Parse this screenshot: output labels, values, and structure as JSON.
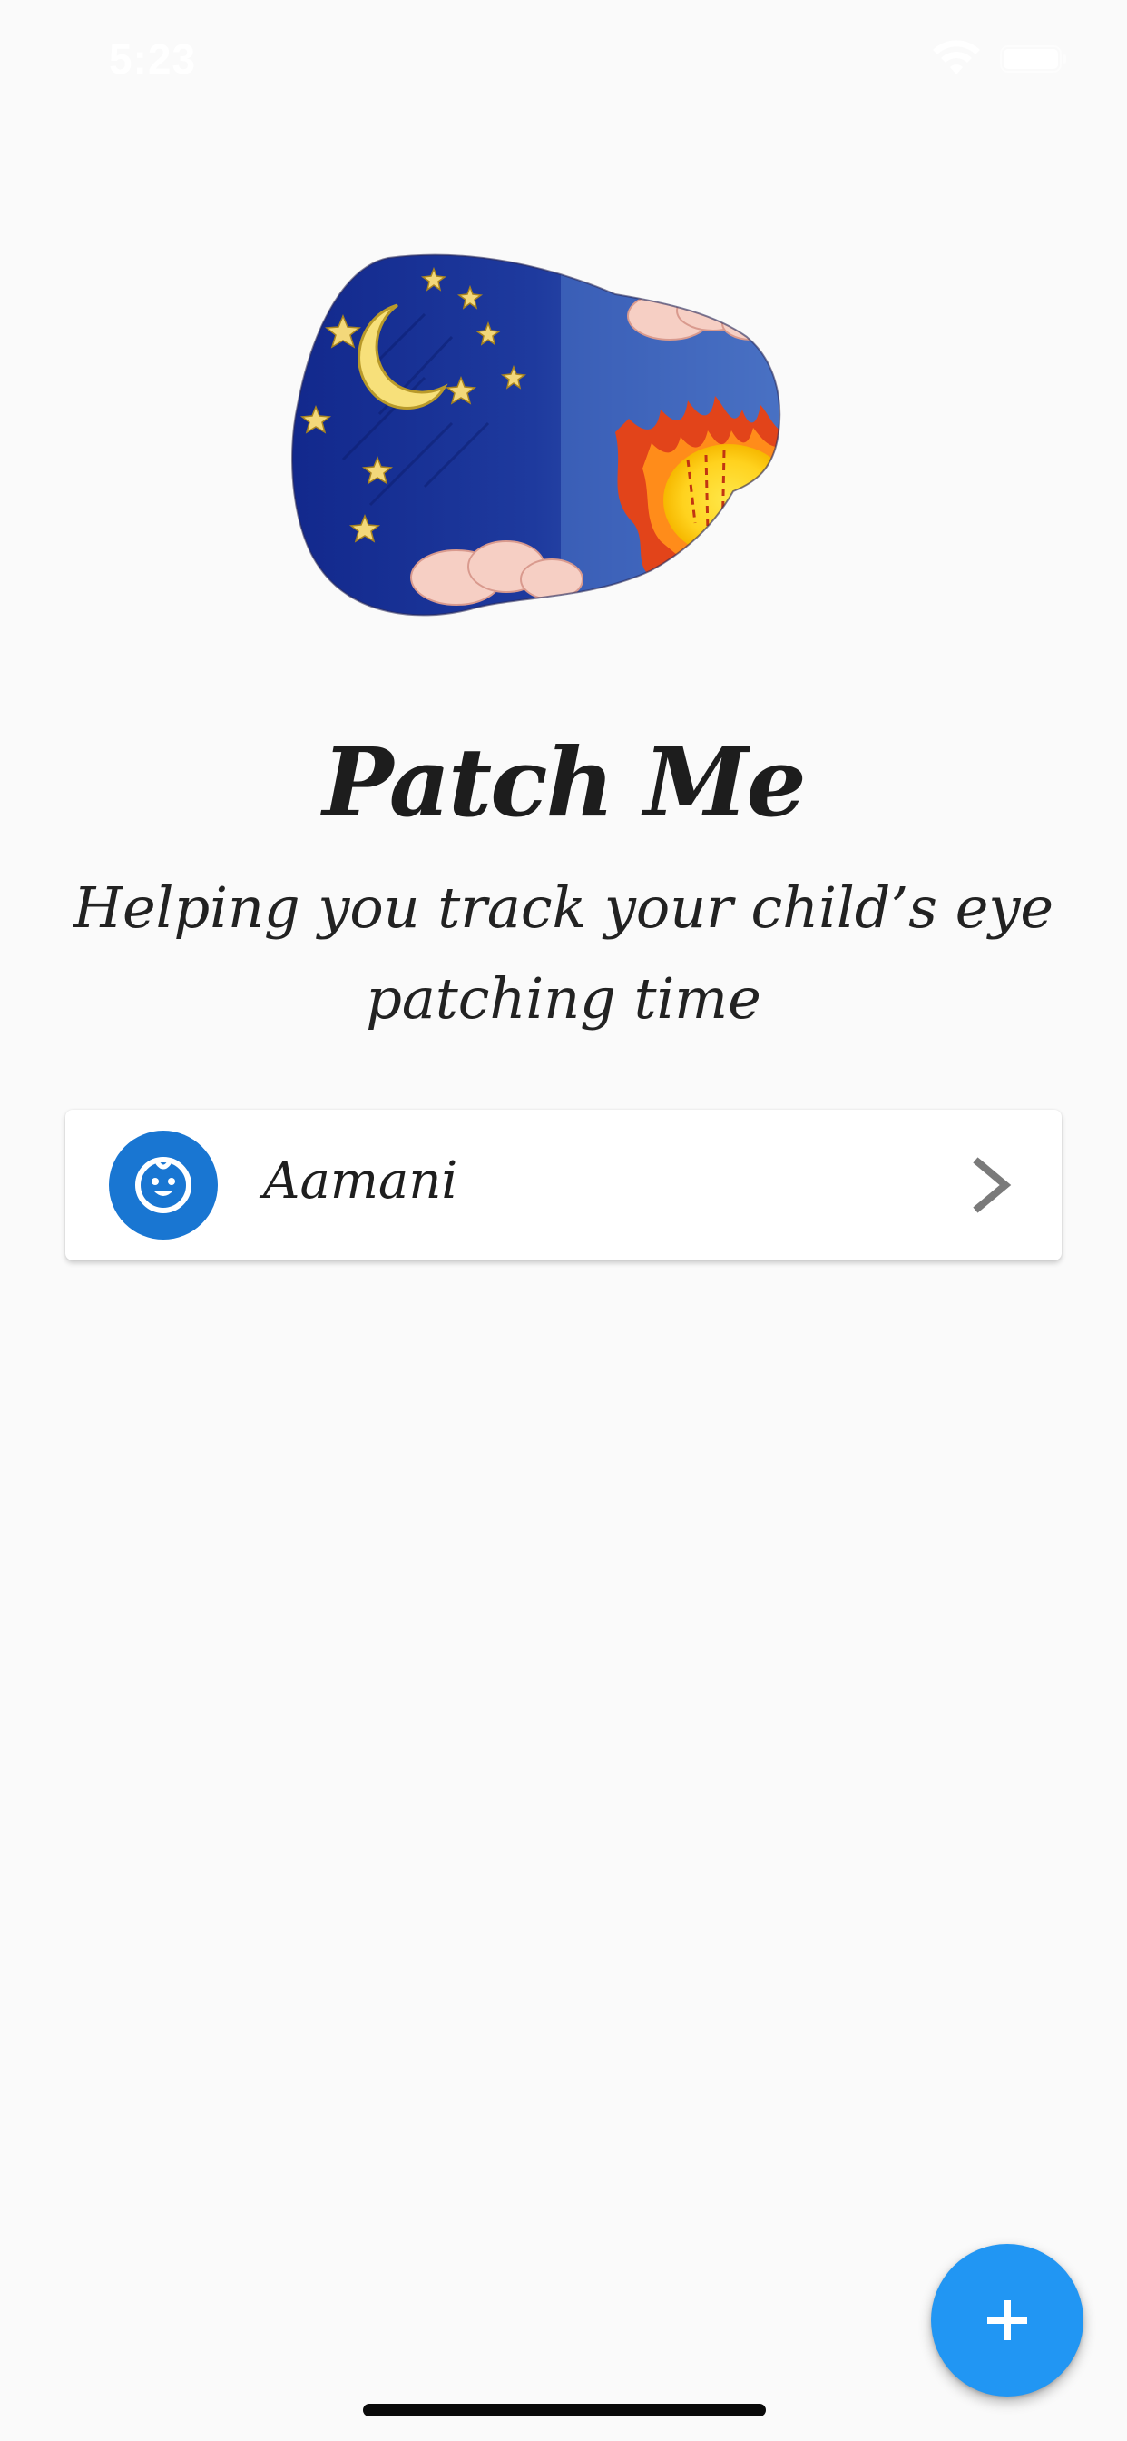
{
  "status_bar": {
    "time": "5:23",
    "wifi_icon": "wifi-icon",
    "battery_icon": "battery-icon"
  },
  "header": {
    "title": "Patch Me",
    "subtitle": "Helping you track your child’s eye patching time"
  },
  "children": [
    {
      "name": "Aamani",
      "avatar_icon": "baby-face-icon",
      "trailing_icon": "chevron-right-icon"
    }
  ],
  "fab": {
    "icon": "plus-icon"
  },
  "colors": {
    "background": "#fafafa",
    "avatar_blue": "#1976d2",
    "fab_blue": "#2196f3",
    "text_dark": "#1d1d1d",
    "chevron_gray": "#7a7a7a"
  }
}
